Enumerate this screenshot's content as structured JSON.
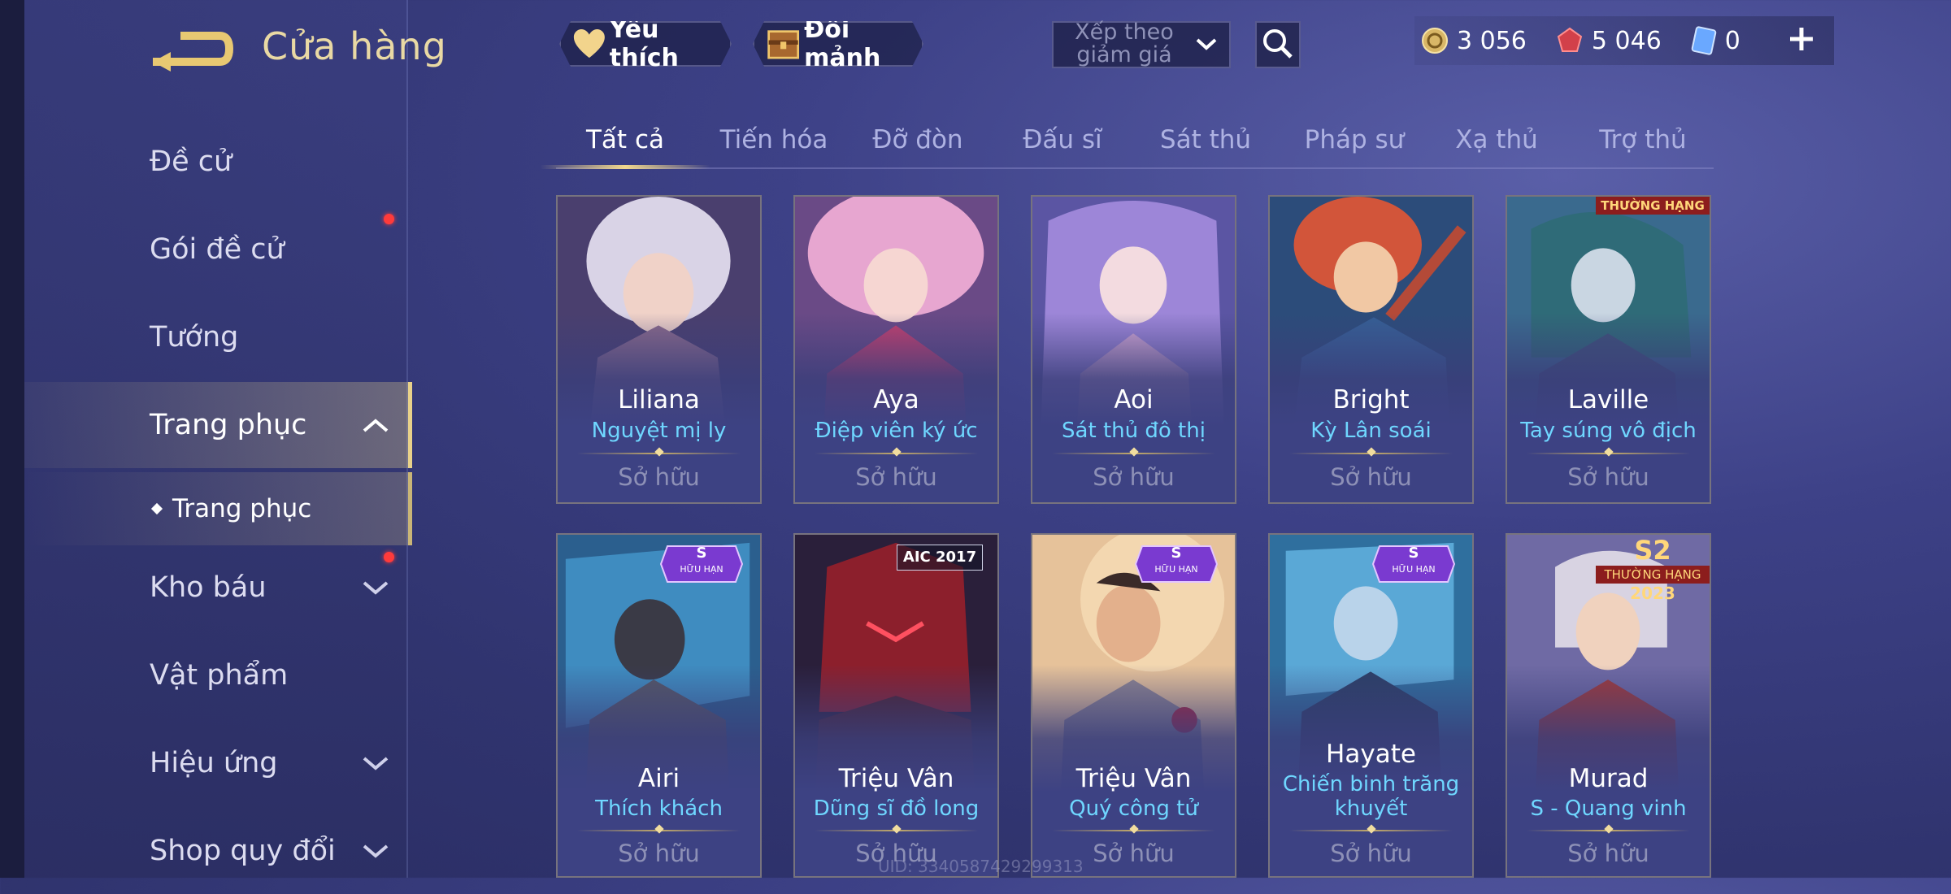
{
  "header": {
    "title": "Cửa hàng",
    "favorite_label": "Yêu thích",
    "exchange_label": "Đổi mảnh",
    "sort_label": "Xếp theo giảm giá",
    "currencies": [
      {
        "name": "gold-coin",
        "value": "3 056"
      },
      {
        "name": "ruby",
        "value": "5 046"
      },
      {
        "name": "voucher",
        "value": "0"
      }
    ]
  },
  "sidebar": {
    "items": [
      {
        "label": "Đề cử"
      },
      {
        "label": "Gói đề cử"
      },
      {
        "label": "Tướng"
      },
      {
        "label": "Trang phục"
      },
      {
        "label": "Trang phục"
      },
      {
        "label": "Kho báu"
      },
      {
        "label": "Vật phẩm"
      },
      {
        "label": "Hiệu ứng"
      },
      {
        "label": "Shop quy đổi"
      }
    ]
  },
  "tabs": [
    "Tất cả",
    "Tiến hóa",
    "Đỡ đòn",
    "Đấu sĩ",
    "Sát thủ",
    "Pháp sư",
    "Xạ thủ",
    "Trợ thủ"
  ],
  "cards": [
    {
      "hero": "Liliana",
      "skin": "Nguyệt mị ly",
      "status": "Sở hữu",
      "color": "#b59cc4"
    },
    {
      "hero": "Aya",
      "skin": "Điệp viên ký ức",
      "status": "Sở hữu",
      "color": "#c6608f"
    },
    {
      "hero": "Aoi",
      "skin": "Sát thủ đô thị",
      "status": "Sở hữu",
      "color": "#7d6fc8"
    },
    {
      "hero": "Bright",
      "skin": "Kỳ Lân soái",
      "status": "Sở hữu",
      "color": "#c0563f"
    },
    {
      "hero": "Laville",
      "skin": "Tay súng vô địch",
      "status": "Sở hữu",
      "color": "#4f7fa4",
      "badge": "THƯỜNG HẠNG"
    },
    {
      "hero": "Airi",
      "skin": "Thích khách",
      "status": "Sở hữu",
      "color": "#3f7fb0",
      "badge_s": "S",
      "badge_s_sub": "HỮU HẠN"
    },
    {
      "hero": "Triệu Vân",
      "skin": "Dũng sĩ đồ long",
      "status": "Sở hữu",
      "color": "#8c2634",
      "badge": "AIC 2017"
    },
    {
      "hero": "Triệu Vân",
      "skin": "Quý công tử",
      "status": "Sở hữu",
      "color": "#d9a277",
      "badge_s": "S",
      "badge_s_sub": "HỮU HẠN"
    },
    {
      "hero": "Hayate",
      "skin": "Chiến binh trăng khuyết",
      "status": "Sở hữu",
      "color": "#4c8fb8",
      "badge_s": "S",
      "badge_s_sub": "HỮU HẠN"
    },
    {
      "hero": "Murad",
      "skin": "S - Quang vinh",
      "status": "Sở hữu",
      "color": "#c4a8a0",
      "badge": "S2",
      "badge_sub": "THƯỜNG HẠNG",
      "badge_year": "2023"
    }
  ],
  "uid": "UID: 3340587429299313"
}
